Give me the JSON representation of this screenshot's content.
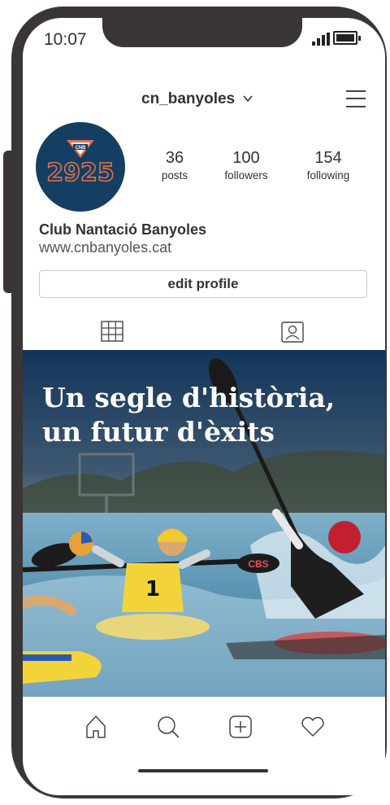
{
  "status_bar": {
    "time": "10:07"
  },
  "header": {
    "username": "cn_banyoles"
  },
  "profile": {
    "logo_text": "2925",
    "logo_badge": "CNB",
    "stats": [
      {
        "value": "36",
        "label": "posts"
      },
      {
        "value": "100",
        "label": "followers"
      },
      {
        "value": "154",
        "label": "following"
      }
    ],
    "name": "Club Nantació Banyoles",
    "website": "www.cnbanyoles.cat",
    "edit_label": "edit profile"
  },
  "post": {
    "headline_line1": "Un segle d'història,",
    "headline_line2": "un futur d'èxits",
    "player_number": "1",
    "paddle_text": "CBS"
  },
  "colors": {
    "hero_navy": "#153e63",
    "logo_orange": "#e2704e",
    "phone_frame": "#3a3635"
  }
}
